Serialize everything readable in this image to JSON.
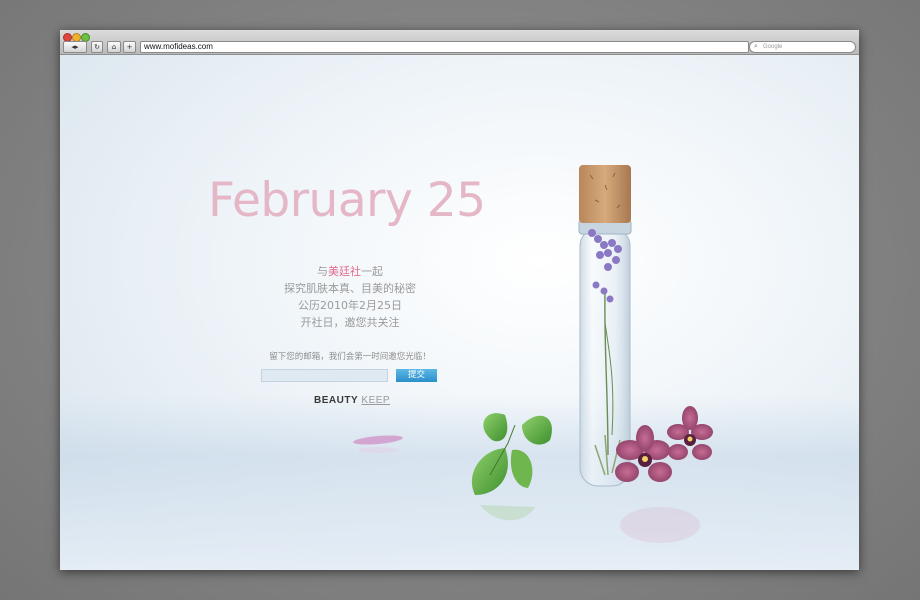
{
  "browser": {
    "url": "www.mofideas.com",
    "search_placeholder": "Google",
    "nav": {
      "back_icon": "back-arrow-icon",
      "forward_icon": "forward-arrow-icon",
      "reload_icon": "reload-icon",
      "bookmark_icon": "bookmark-icon",
      "add_icon": "plus-icon"
    },
    "search_icon": "magnifier-icon"
  },
  "page": {
    "headline": "February 25",
    "intro": {
      "line1_pre": "与",
      "line1_brand": "美廷社",
      "line1_post": "一起",
      "line2": "探究肌肤本真、目美的秘密",
      "line3": "公历2010年2月25日",
      "line4": "开社日，邀您共关注"
    },
    "signup": {
      "prompt": "留下您的邮箱，我们会第一时间邀您光临！",
      "email_value": "",
      "submit_label": "提交"
    },
    "logo": {
      "part1": "BEAUTY",
      "part2": "KEEP"
    }
  },
  "colors": {
    "headline": "#e5b6c6",
    "brand": "#e36a8c",
    "button": "#2a8fca"
  }
}
